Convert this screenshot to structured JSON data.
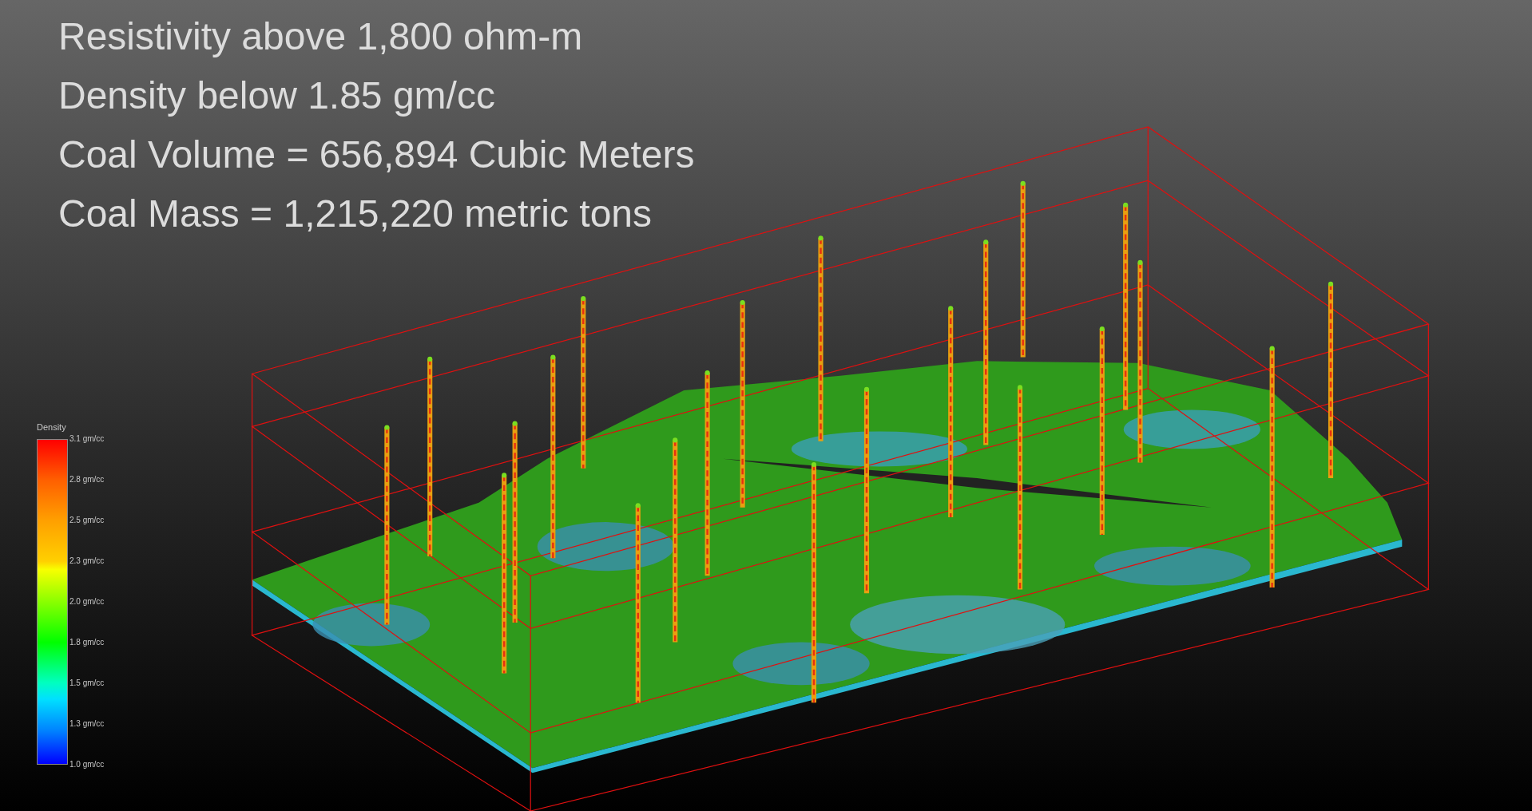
{
  "summary_lines": [
    "Resistivity above 1,800 ohm-m",
    "Density below 1.85 gm/cc",
    "Coal Volume = 656,894 Cubic Meters",
    "Coal Mass = 1,215,220 metric tons"
  ],
  "legend": {
    "title": "Density",
    "labels": [
      "3.1 gm/cc",
      "2.8 gm/cc",
      "2.5 gm/cc",
      "2.3 gm/cc",
      "2.0 gm/cc",
      "1.8 gm/cc",
      "1.5 gm/cc",
      "1.3 gm/cc",
      "1.0 gm/cc"
    ]
  }
}
